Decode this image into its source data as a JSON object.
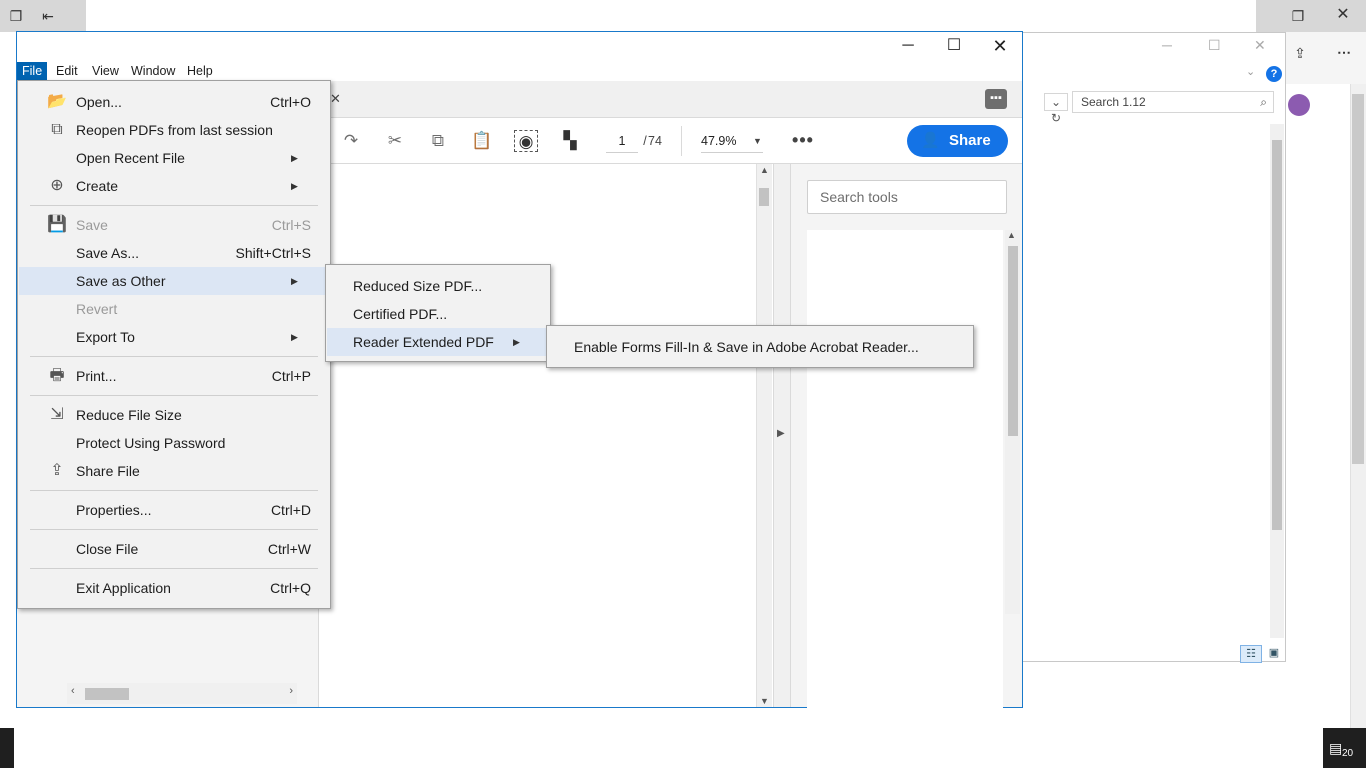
{
  "background": {
    "search_placeholder": "Search 1.12",
    "notification_count": "20"
  },
  "acrobat": {
    "menubar": [
      "File",
      "Edit",
      "View",
      "Window",
      "Help"
    ],
    "toolbar": {
      "page_current": "1",
      "page_separator": "/",
      "page_total": "74",
      "zoom": "47.9%",
      "share_label": "Share"
    },
    "tools_search_placeholder": "Search tools"
  },
  "file_menu": {
    "items": [
      {
        "label": "Open...",
        "shortcut": "Ctrl+O",
        "icon": "folder-open-icon"
      },
      {
        "label": "Reopen PDFs from last session",
        "shortcut": "",
        "icon": "reopen-icon"
      },
      {
        "label": "Open Recent File",
        "shortcut": "",
        "icon": ""
      },
      {
        "label": "Create",
        "shortcut": "",
        "icon": "create-icon"
      },
      {
        "label": "Save",
        "shortcut": "Ctrl+S",
        "icon": "save-icon"
      },
      {
        "label": "Save As...",
        "shortcut": "Shift+Ctrl+S",
        "icon": ""
      },
      {
        "label": "Save as Other",
        "shortcut": "",
        "icon": ""
      },
      {
        "label": "Revert",
        "shortcut": "",
        "icon": ""
      },
      {
        "label": "Export To",
        "shortcut": "",
        "icon": ""
      },
      {
        "label": "Print...",
        "shortcut": "Ctrl+P",
        "icon": "printer-icon"
      },
      {
        "label": "Reduce File Size",
        "shortcut": "",
        "icon": "reduce-size-icon"
      },
      {
        "label": "Protect Using Password",
        "shortcut": "",
        "icon": ""
      },
      {
        "label": "Share File",
        "shortcut": "",
        "icon": "share-file-icon"
      },
      {
        "label": "Properties...",
        "shortcut": "Ctrl+D",
        "icon": ""
      },
      {
        "label": "Close File",
        "shortcut": "Ctrl+W",
        "icon": ""
      },
      {
        "label": "Exit Application",
        "shortcut": "Ctrl+Q",
        "icon": ""
      }
    ]
  },
  "save_as_other_submenu": {
    "items": [
      "Reduced Size PDF...",
      "Certified PDF...",
      "Reader Extended PDF"
    ]
  },
  "reader_extended_submenu": {
    "items": [
      "Enable Forms Fill-In & Save in Adobe Acrobat Reader..."
    ]
  }
}
